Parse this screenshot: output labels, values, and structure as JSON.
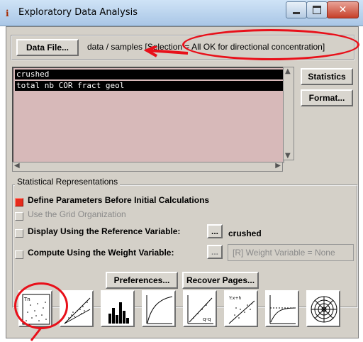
{
  "window": {
    "title": "Exploratory Data Analysis"
  },
  "colors": {
    "annotation": "#e8101a",
    "list_background": "#d7b9b9",
    "window_face": "#d4d0c8"
  },
  "data_file": {
    "button_label": "Data File...",
    "path_text": "data / samples [Selection = All OK for directional concentration]"
  },
  "variables": {
    "items": [
      "crushed",
      "total nb COR fract geol"
    ]
  },
  "side_buttons": {
    "statistics": "Statistics",
    "format": "Format..."
  },
  "stat_repr": {
    "title": "Statistical Representations",
    "define_params": "Define Parameters Before Initial Calculations",
    "define_params_checked": true,
    "grid_org": "Use the Grid Organization",
    "grid_org_checked": false,
    "display_ref": "Display Using the Reference Variable:",
    "display_ref_checked": false,
    "ref_button": "...",
    "ref_value": "crushed",
    "weight": "Compute Using the Weight Variable:",
    "weight_checked": false,
    "weight_button": "...",
    "weight_value": "[R] Weight Variable = None",
    "preferences": "Preferences...",
    "recover": "Recover Pages..."
  },
  "plot_icons": [
    {
      "icon": "basemap-icon",
      "label": "Tn"
    },
    {
      "icon": "scatter-plot-icon"
    },
    {
      "icon": "histogram-icon"
    },
    {
      "icon": "cumulative-curve-icon"
    },
    {
      "icon": "qq-plot-icon",
      "label": "q-q"
    },
    {
      "icon": "h-scatter-icon",
      "label": "Y:x+h"
    },
    {
      "icon": "variogram-icon"
    },
    {
      "icon": "rose-diagram-icon"
    }
  ]
}
